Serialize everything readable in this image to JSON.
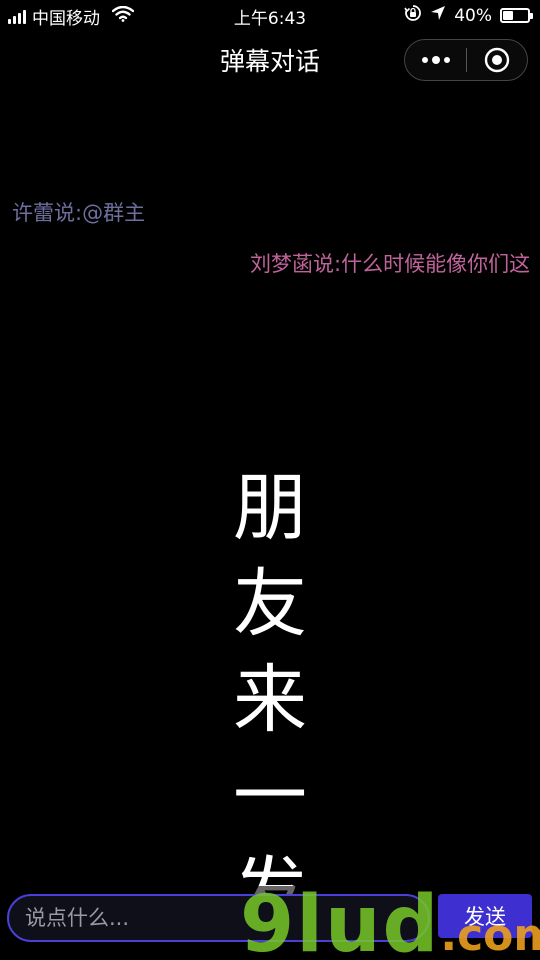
{
  "status_bar": {
    "carrier": "中国移动",
    "time": "上午6:43",
    "battery_text": "40%",
    "battery_level": 0.4,
    "icons": [
      "signal-icon",
      "wifi-icon",
      "orientation-lock-icon",
      "location-arrow-icon",
      "battery-icon"
    ]
  },
  "nav": {
    "title": "弹幕对话",
    "capsule_icons": [
      "more-dots-icon",
      "close-target-icon"
    ]
  },
  "danmaku": [
    {
      "text": "许蕾说:@群主",
      "color": "#6e6f9f"
    },
    {
      "text": "刘梦菡说:什么时候能像你们这",
      "color": "#c0639b"
    }
  ],
  "big_text": [
    "朋",
    "友",
    "来",
    "一",
    "发"
  ],
  "input": {
    "placeholder": "说点什么...",
    "value": "",
    "send_label": "发送",
    "accent": "#3e2fd0"
  },
  "watermark": {
    "main": "9lud",
    "suffix": ".com"
  }
}
